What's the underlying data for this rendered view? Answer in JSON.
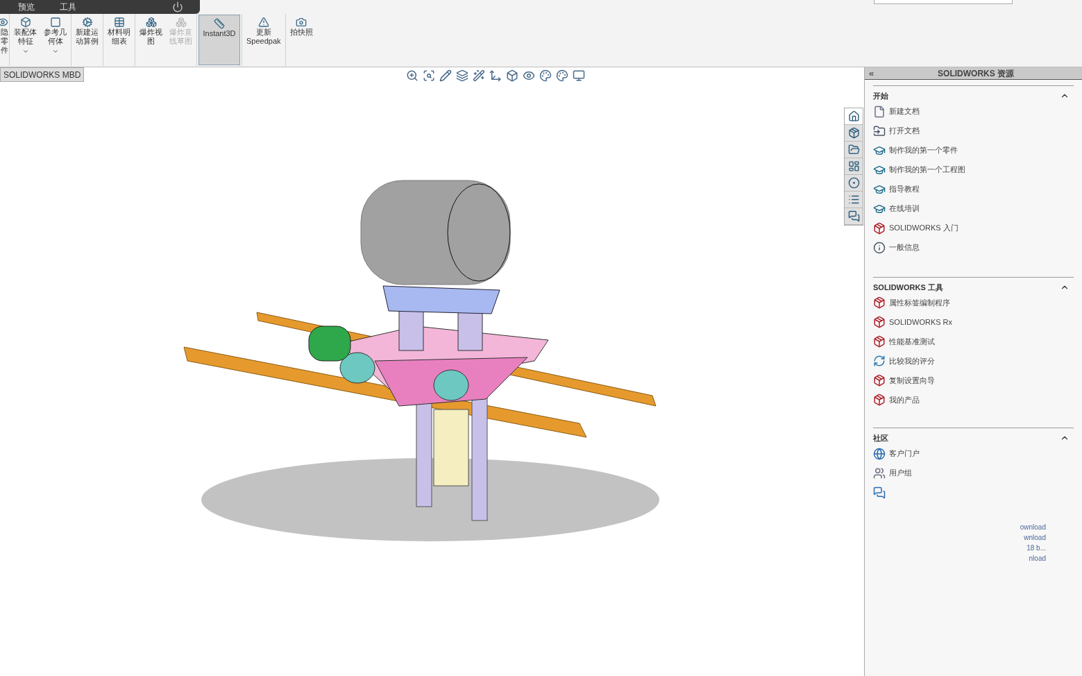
{
  "menu_bar": {
    "items": [
      "预览",
      "工具"
    ]
  },
  "toolbar": {
    "items": [
      {
        "lines": [
          "隐",
          "零",
          "件"
        ],
        "dropdown": false,
        "disabled": false,
        "selected": false
      },
      {
        "lines": [
          "装配体",
          "特征"
        ],
        "dropdown": true,
        "disabled": false,
        "selected": false
      },
      {
        "lines": [
          "参考几",
          "何体"
        ],
        "dropdown": true,
        "disabled": false,
        "selected": false
      },
      {
        "lines": [
          "新建运",
          "动算例"
        ],
        "dropdown": false,
        "disabled": false,
        "selected": false
      },
      {
        "lines": [
          "材料明",
          "细表"
        ],
        "dropdown": false,
        "disabled": false,
        "selected": false
      },
      {
        "lines": [
          "爆炸视",
          "图"
        ],
        "dropdown": false,
        "disabled": false,
        "selected": false
      },
      {
        "lines": [
          "爆炸直",
          "线草图"
        ],
        "dropdown": false,
        "disabled": true,
        "selected": false
      },
      {
        "lines": [
          "Instant3D"
        ],
        "dropdown": false,
        "disabled": false,
        "selected": true
      },
      {
        "lines": [
          "更新",
          "Speedpak"
        ],
        "dropdown": false,
        "disabled": false,
        "selected": false
      },
      {
        "lines": [
          "拍快照"
        ],
        "dropdown": false,
        "disabled": false,
        "selected": false
      }
    ]
  },
  "tabs": [
    {
      "label": "SOLIDWORKS MBD",
      "selected": true
    }
  ],
  "task_pane": {
    "title": "SOLIDWORKS 资源",
    "collapse": "«",
    "side_tabs": [
      {
        "selected": true
      },
      {
        "selected": false
      },
      {
        "selected": false
      },
      {
        "selected": false
      },
      {
        "selected": false
      },
      {
        "selected": false
      },
      {
        "selected": false
      }
    ],
    "sections": [
      {
        "title": "开始",
        "expanded": true,
        "items": [
          {
            "label": "新建文档"
          },
          {
            "label": "打开文档"
          },
          {
            "label": "制作我的第一个零件"
          },
          {
            "label": "制作我的第一个工程图"
          },
          {
            "label": "指导教程"
          },
          {
            "label": "在线培训"
          },
          {
            "label": "SOLIDWORKS 入门"
          },
          {
            "label": "一般信息"
          }
        ]
      },
      {
        "title": "SOLIDWORKS 工具",
        "expanded": true,
        "items": [
          {
            "label": "属性标签编制程序"
          },
          {
            "label": "SOLIDWORKS Rx"
          },
          {
            "label": "性能基准测试"
          },
          {
            "label": "比较我的评分"
          },
          {
            "label": "复制设置向导"
          },
          {
            "label": "我的产品"
          }
        ]
      },
      {
        "title": "社区",
        "expanded": true,
        "items": [
          {
            "label": "客户门户"
          },
          {
            "label": "用户组"
          }
        ]
      }
    ],
    "news_fragments": [
      "ownload",
      "wnload",
      "18 b...",
      "nload"
    ]
  }
}
